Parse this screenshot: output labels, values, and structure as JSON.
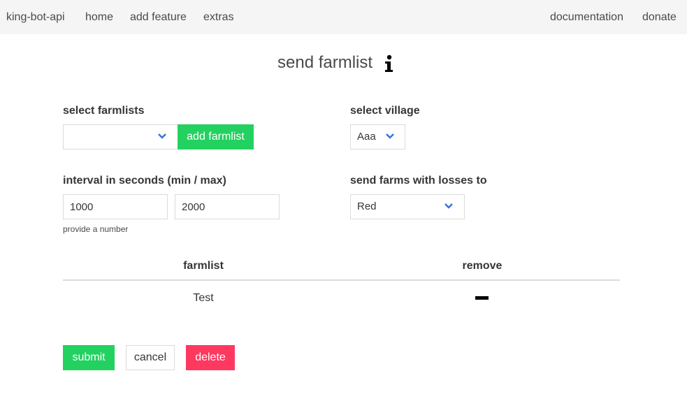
{
  "nav": {
    "brand": "king-bot-api",
    "home": "home",
    "add_feature": "add feature",
    "extras": "extras",
    "documentation": "documentation",
    "donate": "donate"
  },
  "title": "send farmlist",
  "icons": {
    "info": "info-icon",
    "chevron": "chevron-down-icon",
    "remove": "minus-icon"
  },
  "form": {
    "farmlists": {
      "label": "select farmlists",
      "selected": "",
      "add_button": "add farmlist"
    },
    "village": {
      "label": "select village",
      "selected": "Aaa"
    },
    "interval": {
      "label": "interval in seconds (min / max)",
      "min": "1000",
      "max": "2000",
      "help": "provide a number"
    },
    "losses": {
      "label": "send farms with losses to",
      "selected": "Red"
    }
  },
  "table": {
    "headers": [
      "farmlist",
      "remove"
    ],
    "rows": [
      {
        "farmlist": "Test"
      }
    ]
  },
  "buttons": {
    "submit": "submit",
    "cancel": "cancel",
    "delete": "delete"
  },
  "colors": {
    "accent_green": "#23d160",
    "danger_red": "#ff3860",
    "link_blue": "#3273dc",
    "navbar_bg": "#f5f5f5"
  }
}
